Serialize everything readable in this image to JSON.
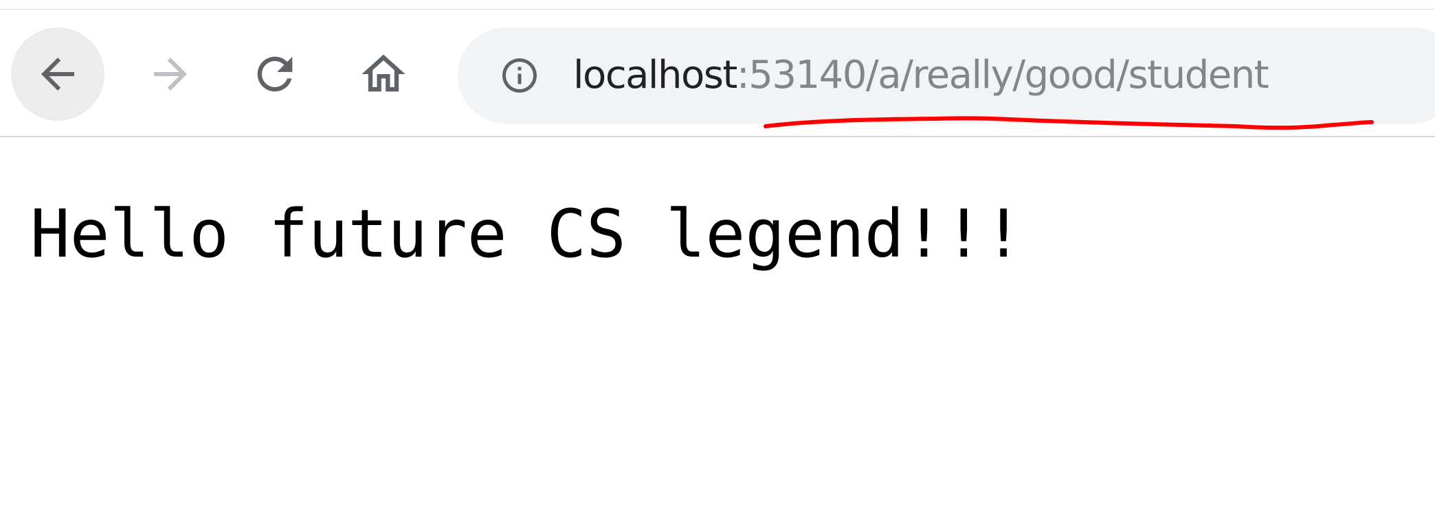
{
  "toolbar": {
    "back_icon": "arrow-left-icon",
    "forward_icon": "arrow-right-icon",
    "reload_icon": "reload-icon",
    "home_icon": "home-icon"
  },
  "address_bar": {
    "info_icon": "info-icon",
    "host": "localhost",
    "path": ":53140/a/really/good/student",
    "annotation_color": "#ff0000"
  },
  "page": {
    "text": "Hello future CS legend!!!"
  }
}
